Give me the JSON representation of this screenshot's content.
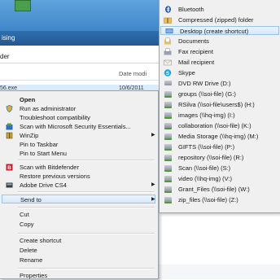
{
  "background": {
    "breadcrumb": "ising",
    "folder_label": "der",
    "column_header": "Date modi",
    "file_name": "56.exe",
    "file_date": "10/6/2011"
  },
  "context_menu": {
    "items": [
      {
        "label": "Open",
        "icon": "",
        "bold": true
      },
      {
        "label": "Run as administrator",
        "icon": "shield-icon"
      },
      {
        "label": "Troubleshoot compatibility",
        "icon": ""
      },
      {
        "label": "Scan with Microsoft Security Essentials...",
        "icon": "security-essentials-icon"
      },
      {
        "label": "WinZip",
        "icon": "winzip-icon",
        "submenu": true
      },
      {
        "label": "Pin to Taskbar",
        "icon": ""
      },
      {
        "label": "Pin to Start Menu",
        "icon": ""
      },
      {
        "label": "Scan with Bitdefender",
        "icon": "bitdefender-icon"
      },
      {
        "label": "Restore previous versions",
        "icon": ""
      },
      {
        "label": "Adobe Drive CS4",
        "icon": "adobe-drive-icon",
        "submenu": true
      },
      {
        "label": "Send to",
        "icon": "",
        "submenu": true,
        "selected": true
      },
      {
        "label": "Cut",
        "icon": ""
      },
      {
        "label": "Copy",
        "icon": ""
      },
      {
        "label": "Create shortcut",
        "icon": ""
      },
      {
        "label": "Delete",
        "icon": ""
      },
      {
        "label": "Rename",
        "icon": ""
      },
      {
        "label": "Properties",
        "icon": ""
      }
    ]
  },
  "send_to_menu": {
    "items": [
      {
        "label": "Bluetooth",
        "icon": "bluetooth-icon"
      },
      {
        "label": "Compressed (zipped) folder",
        "icon": "zip-folder-icon"
      },
      {
        "label": "Desktop (create shortcut)",
        "icon": "desktop-icon",
        "selected": true
      },
      {
        "label": "Documents",
        "icon": "documents-icon"
      },
      {
        "label": "Fax recipient",
        "icon": "fax-icon"
      },
      {
        "label": "Mail recipient",
        "icon": "mail-icon"
      },
      {
        "label": "Skype",
        "icon": "skype-icon"
      },
      {
        "label": "DVD RW Drive (D:)",
        "icon": "dvd-drive-icon"
      },
      {
        "label": "groups (\\\\soi-file) (G:)",
        "icon": "network-drive-icon"
      },
      {
        "label": "RSilva (\\\\soi-file\\users$) (H:)",
        "icon": "network-drive-icon"
      },
      {
        "label": "images (\\\\hq-img) (I:)",
        "icon": "network-drive-icon"
      },
      {
        "label": "collaboration (\\\\soi-file) (K:)",
        "icon": "network-drive-icon"
      },
      {
        "label": "Media Storage (\\\\hq-img) (M:)",
        "icon": "network-drive-icon"
      },
      {
        "label": "GIFTS (\\\\soi-file) (P:)",
        "icon": "network-drive-icon"
      },
      {
        "label": "repository (\\\\soi-file) (R:)",
        "icon": "network-drive-icon"
      },
      {
        "label": "Scan (\\\\soi-file) (S:)",
        "icon": "network-drive-icon"
      },
      {
        "label": "video (\\\\hq-img) (V:)",
        "icon": "network-drive-icon"
      },
      {
        "label": "Grant_Files (\\\\soi-file) (W:)",
        "icon": "network-drive-icon"
      },
      {
        "label": "zip_files (\\\\soi-file) (Z:)",
        "icon": "network-drive-icon"
      }
    ]
  }
}
